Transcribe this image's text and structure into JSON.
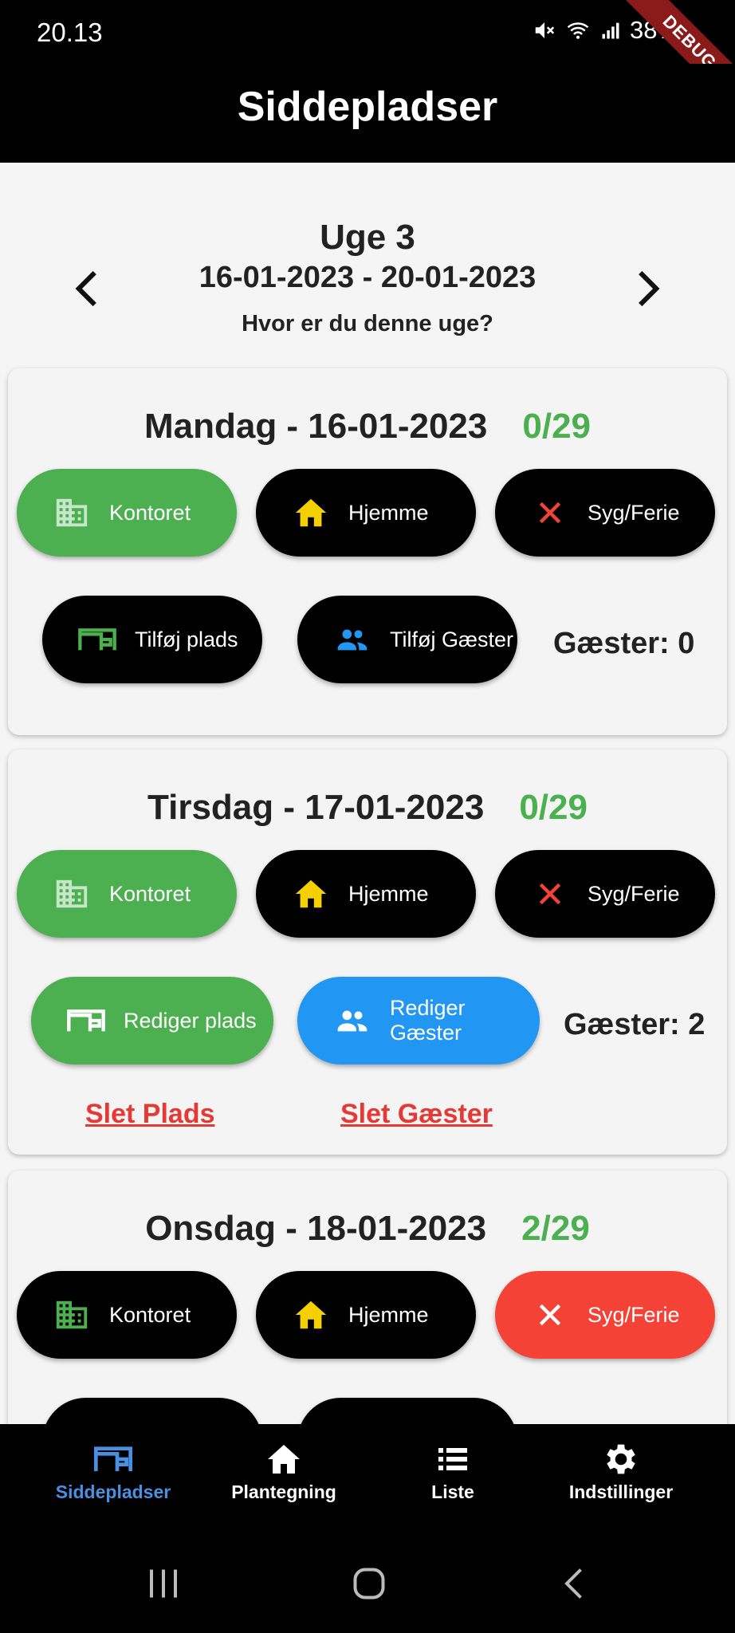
{
  "status_bar": {
    "time": "20.13",
    "battery": "38%",
    "debug_label": "DEBUG"
  },
  "app_bar": {
    "title": "Siddepladser"
  },
  "week": {
    "title": "Uge 3",
    "range": "16-01-2023 - 20-01-2023",
    "question": "Hvor er du denne uge?"
  },
  "days": [
    {
      "label": "Mandag - 16-01-2023",
      "count": "0/29",
      "office_label": "Kontoret",
      "home_label": "Hjemme",
      "sick_label": "Syg/Ferie",
      "seat_label": "Tilføj plads",
      "guest_label": "Tilføj Gæster",
      "guests_text": "Gæster: 0"
    },
    {
      "label": "Tirsdag - 17-01-2023",
      "count": "0/29",
      "office_label": "Kontoret",
      "home_label": "Hjemme",
      "sick_label": "Syg/Ferie",
      "seat_label": "Rediger plads",
      "guest_label": "Rediger Gæster",
      "guests_text": "Gæster: 2",
      "delete_seat": "Slet Plads",
      "delete_guests": "Slet Gæster"
    },
    {
      "label": "Onsdag - 18-01-2023",
      "count": "2/29",
      "office_label": "Kontoret",
      "home_label": "Hjemme",
      "sick_label": "Syg/Ferie"
    }
  ],
  "bottom_nav": {
    "items": [
      {
        "label": "Siddepladser",
        "icon": "desk-icon"
      },
      {
        "label": "Plantegning",
        "icon": "home-icon"
      },
      {
        "label": "Liste",
        "icon": "list-icon"
      },
      {
        "label": "Indstillinger",
        "icon": "gear-icon"
      }
    ],
    "active_index": 0
  },
  "colors": {
    "green": "#4caf50",
    "red": "#f44336",
    "blue": "#2196f3",
    "yellow": "#f5d000",
    "active_nav": "#4a90e2"
  }
}
